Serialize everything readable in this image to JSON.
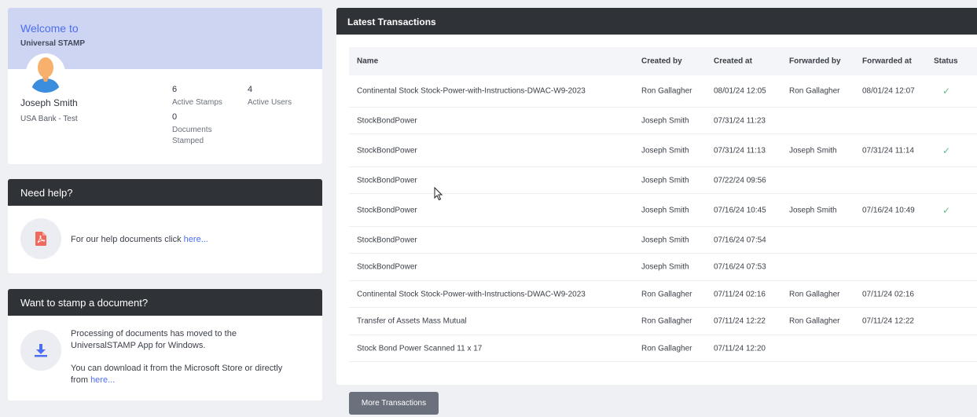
{
  "welcome": {
    "title": "Welcome to",
    "subtitle": "Universal STAMP",
    "user_name": "Joseph Smith",
    "user_org": "USA Bank - Test",
    "stats": {
      "active_stamps_count": "6",
      "active_stamps_label": "Active Stamps",
      "active_users_count": "4",
      "active_users_label": "Active Users",
      "documents_stamped_count": "0",
      "documents_stamped_label": "Documents Stamped"
    }
  },
  "help": {
    "title": "Need help?",
    "text": "For our help documents click ",
    "link": "here...",
    "icon": "pdf-icon"
  },
  "stamp": {
    "title": "Want to stamp a document?",
    "text1": "Processing of documents has moved to the UniversalSTAMP App for Windows.",
    "text2": "You can download it from the Microsoft Store or directly from ",
    "link": "here...",
    "icon": "download-icon"
  },
  "transactions": {
    "title": "Latest Transactions",
    "columns": {
      "name": "Name",
      "created_by": "Created by",
      "created_at": "Created at",
      "forwarded_by": "Forwarded by",
      "forwarded_at": "Forwarded at",
      "status": "Status"
    },
    "rows": [
      {
        "name": "Continental Stock Stock-Power-with-Instructions-DWAC-W9-2023",
        "created_by": "Ron Gallagher",
        "created_at": "08/01/24 12:05",
        "forwarded_by": "Ron Gallagher",
        "forwarded_at": "08/01/24 12:07",
        "status": "✓"
      },
      {
        "name": "StockBondPower",
        "created_by": "Joseph Smith",
        "created_at": "07/31/24 11:23",
        "forwarded_by": "",
        "forwarded_at": "",
        "status": ""
      },
      {
        "name": "StockBondPower",
        "created_by": "Joseph Smith",
        "created_at": "07/31/24 11:13",
        "forwarded_by": "Joseph Smith",
        "forwarded_at": "07/31/24 11:14",
        "status": "✓"
      },
      {
        "name": "StockBondPower",
        "created_by": "Joseph Smith",
        "created_at": "07/22/24 09:56",
        "forwarded_by": "",
        "forwarded_at": "",
        "status": ""
      },
      {
        "name": "StockBondPower",
        "created_by": "Joseph Smith",
        "created_at": "07/16/24 10:45",
        "forwarded_by": "Joseph Smith",
        "forwarded_at": "07/16/24 10:49",
        "status": "✓"
      },
      {
        "name": "StockBondPower",
        "created_by": "Joseph Smith",
        "created_at": "07/16/24 07:54",
        "forwarded_by": "",
        "forwarded_at": "",
        "status": ""
      },
      {
        "name": "StockBondPower",
        "created_by": "Joseph Smith",
        "created_at": "07/16/24 07:53",
        "forwarded_by": "",
        "forwarded_at": "",
        "status": ""
      },
      {
        "name": "Continental Stock Stock-Power-with-Instructions-DWAC-W9-2023",
        "created_by": "Ron Gallagher",
        "created_at": "07/11/24 02:16",
        "forwarded_by": "Ron Gallagher",
        "forwarded_at": "07/11/24 02:16",
        "status": ""
      },
      {
        "name": "Transfer of Assets Mass Mutual",
        "created_by": "Ron Gallagher",
        "created_at": "07/11/24 12:22",
        "forwarded_by": "Ron Gallagher",
        "forwarded_at": "07/11/24 12:22",
        "status": ""
      },
      {
        "name": "Stock Bond Power Scanned 11 x 17",
        "created_by": "Ron Gallagher",
        "created_at": "07/11/24 12:20",
        "forwarded_by": "",
        "forwarded_at": "",
        "status": ""
      }
    ],
    "more_button": "More Transactions"
  },
  "colors": {
    "accent": "#4c6ef0",
    "header_dark": "#2f3237",
    "welcome_bg": "#cdd5f3",
    "status_ok": "#5cc18c"
  }
}
